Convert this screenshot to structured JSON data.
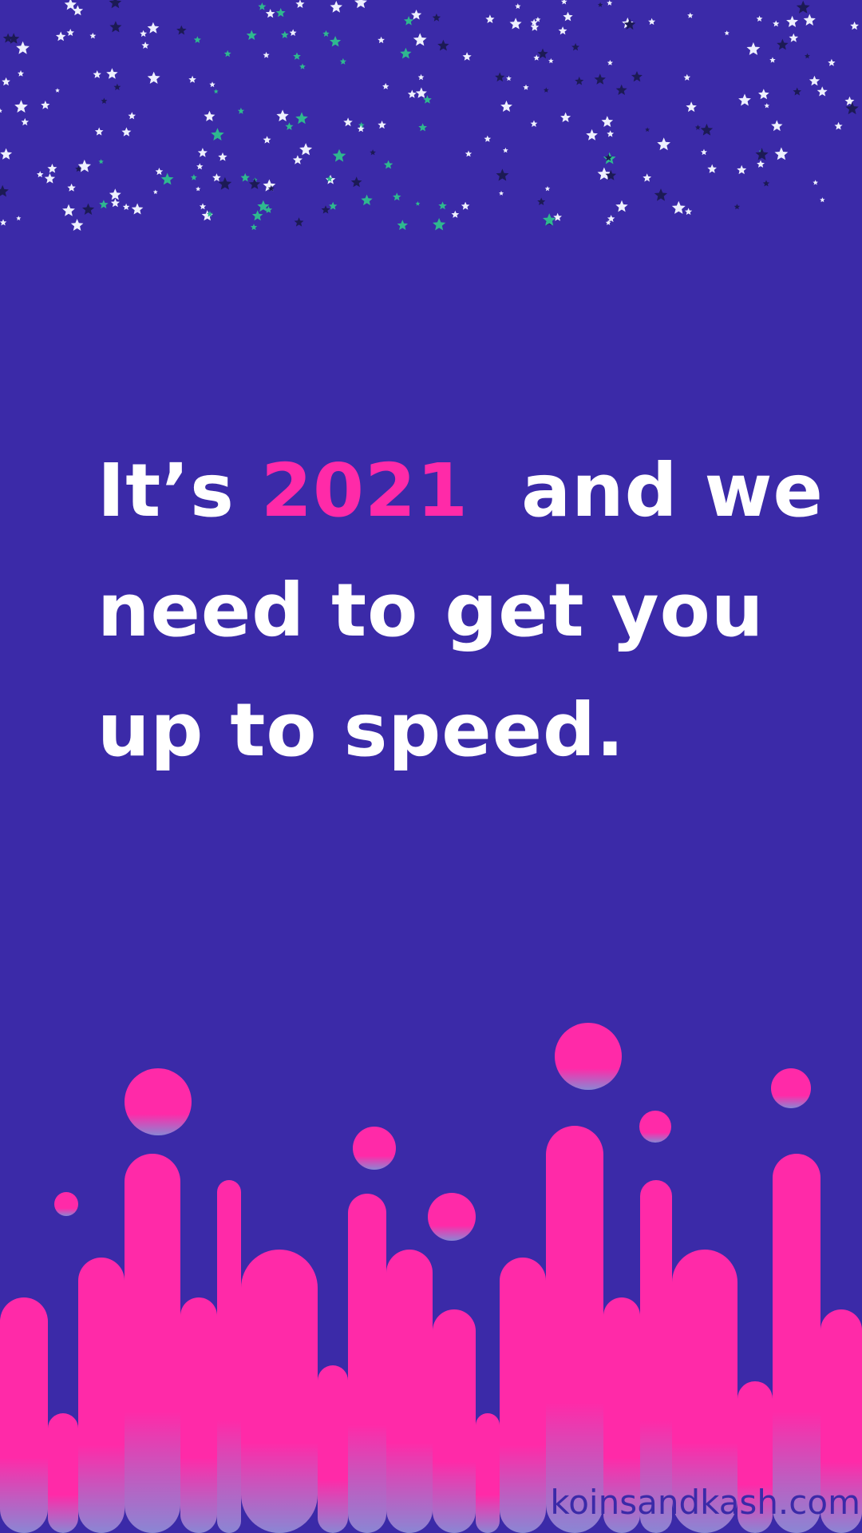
{
  "headline": {
    "line1_pre": "It’s ",
    "line1_accent": "2021",
    "line1_post": "  and we",
    "line2": "need to get you",
    "line3": "up to speed."
  },
  "footer": {
    "url": "koinsandkash.com"
  },
  "colors": {
    "background": "#3b2aa8",
    "accent": "#ff2aa8",
    "text": "#ffffff",
    "star_white": "#eef0ff",
    "star_dark": "#1c1a55",
    "star_green": "#2fb88f"
  }
}
